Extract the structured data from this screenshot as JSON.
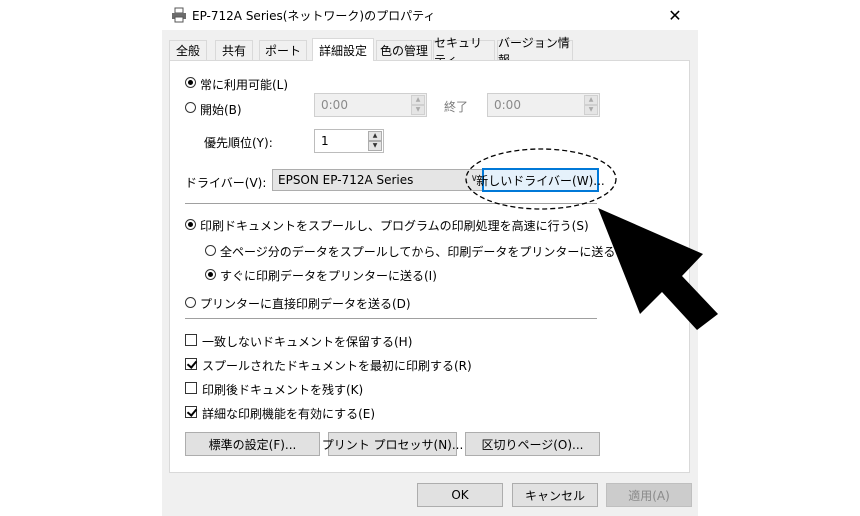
{
  "window": {
    "title": "EP-712A Series(ネットワーク)のプロパティ",
    "close_symbol": "✕"
  },
  "tabs": [
    {
      "label": "全般",
      "active": false
    },
    {
      "label": "共有",
      "active": false
    },
    {
      "label": "ポート",
      "active": false
    },
    {
      "label": "詳細設定",
      "active": true
    },
    {
      "label": "色の管理",
      "active": false
    },
    {
      "label": "セキュリティ",
      "active": false
    },
    {
      "label": "バージョン情報",
      "active": false
    }
  ],
  "availability": {
    "always_label": "常に利用可能(L)",
    "from_label": "開始(B)",
    "from_value": "0:00",
    "to_label": "終了",
    "to_value": "0:00"
  },
  "priority": {
    "label": "優先順位(Y):",
    "value": "1"
  },
  "driver": {
    "label": "ドライバー(V):",
    "selected": "EPSON EP-712A Series",
    "new_driver_button": "新しいドライバー(W)..."
  },
  "spool": {
    "spool_label": "印刷ドキュメントをスプールし、プログラムの印刷処理を高速に行う(S)",
    "after_last_page_label": "全ページ分のデータをスプールしてから、印刷データをプリンターに送る(T)",
    "immediately_label": "すぐに印刷データをプリンターに送る(I)",
    "direct_label": "プリンターに直接印刷データを送る(D)"
  },
  "options": [
    {
      "label": "一致しないドキュメントを保留する(H)",
      "checked": false
    },
    {
      "label": "スプールされたドキュメントを最初に印刷する(R)",
      "checked": true
    },
    {
      "label": "印刷後ドキュメントを残す(K)",
      "checked": false
    },
    {
      "label": "詳細な印刷機能を有効にする(E)",
      "checked": true
    }
  ],
  "bottom_buttons": {
    "defaults": "標準の設定(F)...",
    "processor": "プリント プロセッサ(N)...",
    "separator": "区切りページ(O)..."
  },
  "dialog_buttons": {
    "ok": "OK",
    "cancel": "キャンセル",
    "apply": "適用(A)"
  },
  "annotation": {
    "highlight_icon": "dashed-ellipse-highlight",
    "pointer_icon": "arrow-pointer-icon",
    "color": "#000000"
  }
}
